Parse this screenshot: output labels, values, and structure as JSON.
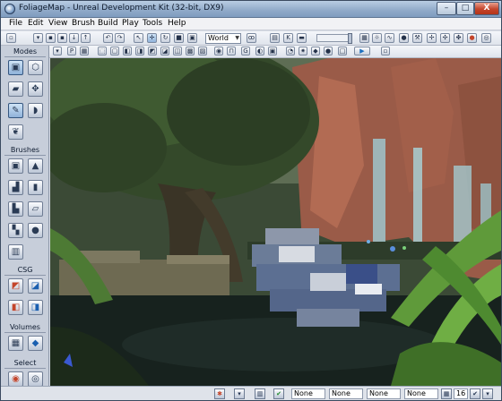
{
  "window": {
    "title": "FoliageMap - Unreal Development Kit (32-bit, DX9)",
    "minimize_label": "–",
    "maximize_label": "□",
    "close_label": "X"
  },
  "menu": [
    "File",
    "Edit",
    "View",
    "Brush",
    "Build",
    "Play",
    "Tools",
    "Help"
  ],
  "toolbar": {
    "coord_system": "World"
  },
  "panel": {
    "modes_label": "Modes",
    "brushes_label": "Brushes",
    "csg_label": "CSG",
    "volumes_label": "Volumes",
    "select_label": "Select"
  },
  "status": {
    "field1": "None",
    "field2": "None",
    "field3": "None",
    "field4": "None",
    "grid_value": "16"
  },
  "colors": {
    "accent": "#8fb2d9",
    "close": "#c4452b"
  }
}
